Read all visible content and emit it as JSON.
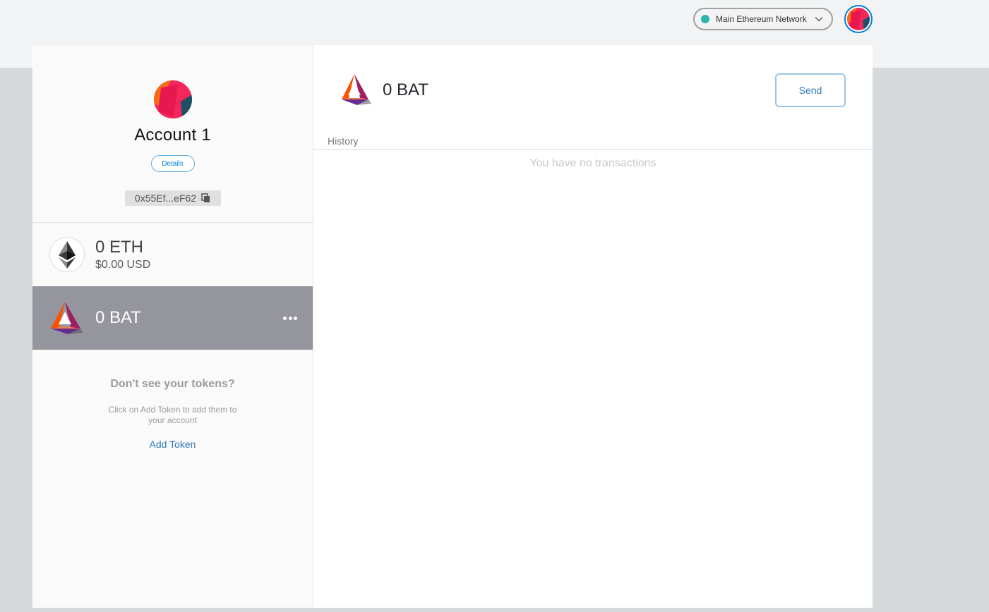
{
  "header": {
    "network": {
      "label": "Main Ethereum Network",
      "dot_color": "#29b6af",
      "icon": "chevron-down-icon"
    },
    "account_avatar_icon": "identicon-icon"
  },
  "sidebar": {
    "account": {
      "name": "Account 1",
      "details_label": "Details",
      "address": "0x55Ef...eF62",
      "copy_icon": "copy-icon"
    },
    "tokens": [
      {
        "amount": "0 ETH",
        "fiat": "$0.00 USD",
        "icon": "ethereum-icon",
        "selected": false
      },
      {
        "amount": "0 BAT",
        "icon": "bat-icon",
        "selected": true,
        "menu_icon": "more-horizontal-icon"
      }
    ],
    "no_tokens": {
      "title": "Don't see your tokens?",
      "description": "Click on Add Token to add them to your account",
      "add_token_label": "Add Token"
    }
  },
  "main": {
    "asset": {
      "amount": "0 BAT",
      "icon": "bat-icon"
    },
    "send_label": "Send",
    "history_label": "History",
    "empty_message": "You have no transactions"
  },
  "colors": {
    "accent": "#037dd6",
    "selected_row": "#95959d",
    "link": "#2f79b9"
  }
}
